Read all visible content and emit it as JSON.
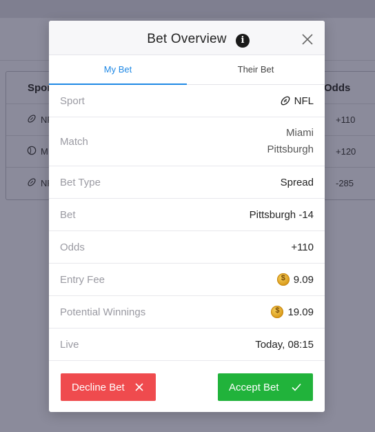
{
  "background": {
    "table": {
      "headers": {
        "sport": "Sport",
        "odds": "Odds"
      },
      "rows": [
        {
          "sport_abbr": "NF",
          "odds": "+110"
        },
        {
          "sport_abbr": "M",
          "odds": "+120"
        },
        {
          "sport_abbr": "NF",
          "odds": "-285"
        }
      ]
    }
  },
  "modal": {
    "title": "Bet Overview",
    "tabs": [
      {
        "label": "My Bet",
        "active": true
      },
      {
        "label": "Their Bet",
        "active": false
      }
    ],
    "details": {
      "sport": {
        "label": "Sport",
        "value": "NFL"
      },
      "match": {
        "label": "Match",
        "team1": "Miami",
        "team2": "Pittsburgh"
      },
      "bet_type": {
        "label": "Bet Type",
        "value": "Spread"
      },
      "bet": {
        "label": "Bet",
        "value": "Pittsburgh -14"
      },
      "odds": {
        "label": "Odds",
        "value": "+110"
      },
      "entry_fee": {
        "label": "Entry Fee",
        "value": "9.09"
      },
      "potential_winnings": {
        "label": "Potential Winnings",
        "value": "19.09"
      },
      "live": {
        "label": "Live",
        "value": "Today, 08:15"
      }
    },
    "buttons": {
      "decline": "Decline Bet",
      "accept": "Accept Bet"
    }
  },
  "colors": {
    "accent": "#1e88e5",
    "decline": "#ef4b4e",
    "accept": "#21b33b",
    "overlay": "#8b8b9b"
  }
}
